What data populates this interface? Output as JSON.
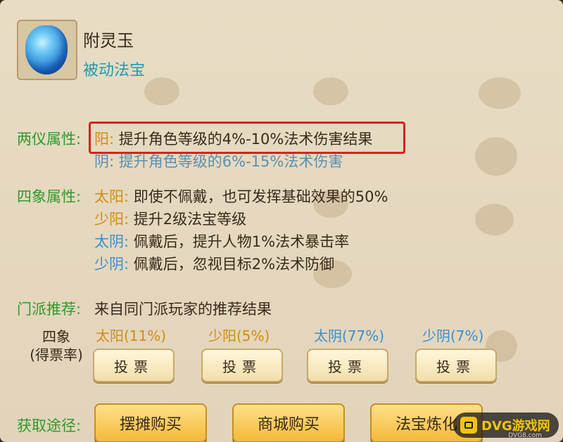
{
  "item": {
    "name": "附灵玉",
    "type": "被动法宝"
  },
  "liangyi": {
    "label": "两仪属性:",
    "yang_key": "阳:",
    "yang_text": "提升角色等级的4%-10%法术伤害结果",
    "yin_key": "阴:",
    "yin_text": "提升角色等级的6%-15%法术伤害"
  },
  "sixiang": {
    "label": "四象属性:",
    "rows": [
      {
        "key": "太阳:",
        "text": "即使不佩戴，也可发挥基础效果的50%"
      },
      {
        "key": "少阳:",
        "text": "提升2级法宝等级"
      },
      {
        "key": "太阴:",
        "text": "佩戴后，提升人物1%法术暴击率"
      },
      {
        "key": "少阴:",
        "text": "佩戴后，忽视目标2%法术防御"
      }
    ]
  },
  "recommend": {
    "label": "门派推荐:",
    "text": "来自同门派玩家的推荐结果"
  },
  "vote": {
    "side_line1": "四象",
    "side_line2": "(得票率)",
    "options": [
      {
        "label": "太阳(11%)",
        "button": "投票"
      },
      {
        "label": "少阳(5%)",
        "button": "投票"
      },
      {
        "label": "太阴(77%)",
        "button": "投票"
      },
      {
        "label": "少阴(7%)",
        "button": "投票"
      }
    ]
  },
  "obtain": {
    "label": "获取途径:",
    "buttons": [
      "摆摊购买",
      "商城购买",
      "法宝炼化"
    ]
  },
  "watermark": {
    "text": "DVG游戏网",
    "sub": "DVG8.com"
  }
}
